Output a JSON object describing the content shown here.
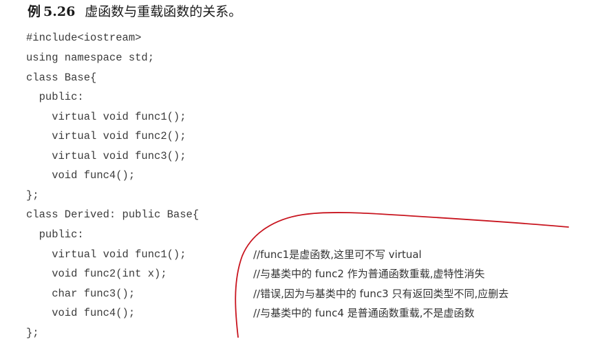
{
  "heading": {
    "label": "例",
    "number": "5.26",
    "text": "虚函数与重载函数的关系。"
  },
  "code": [
    "#include<iostream>",
    "using namespace std;",
    "class Base{",
    "  public:",
    "    virtual void func1();",
    "    virtual void func2();",
    "    virtual void func3();",
    "    void func4();",
    "};",
    "class Derived: public Base{",
    "  public:",
    "    virtual void func1();",
    "    void func2(int x);",
    "    char func3();",
    "    void func4();",
    "};"
  ],
  "comments": [
    "//func1是虚函数,这里可不写 virtual",
    "//与基类中的 func2 作为普通函数重载,虚特性消失",
    "//错误,因为与基类中的 func3 只有返回类型不同,应删去",
    "//与基类中的 func4 是普通函数重载,不是虚函数"
  ],
  "annotation": {
    "stroke_color": "#c8141e"
  }
}
